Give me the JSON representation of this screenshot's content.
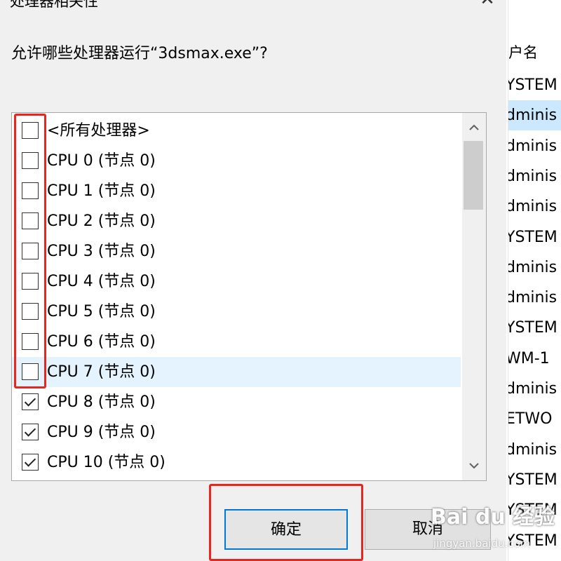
{
  "dialog": {
    "title": "处理器相关性",
    "close_icon": "✕",
    "question": "允许哪些处理器运行“3dsmax.exe”?",
    "ok_label": "确定",
    "cancel_label": "取消"
  },
  "processor_list": {
    "items": [
      {
        "label": "<所有处理器>",
        "checked": false
      },
      {
        "label": "CPU 0 (节点 0)",
        "checked": false
      },
      {
        "label": "CPU 1 (节点 0)",
        "checked": false
      },
      {
        "label": "CPU 2 (节点 0)",
        "checked": false
      },
      {
        "label": "CPU 3 (节点 0)",
        "checked": false
      },
      {
        "label": "CPU 4 (节点 0)",
        "checked": false
      },
      {
        "label": "CPU 5 (节点 0)",
        "checked": false
      },
      {
        "label": "CPU 6 (节点 0)",
        "checked": false
      },
      {
        "label": "CPU 7 (节点 0)",
        "checked": false,
        "highlighted": true
      },
      {
        "label": "CPU 8 (节点 0)",
        "checked": true
      },
      {
        "label": "CPU 9 (节点 0)",
        "checked": true
      },
      {
        "label": "CPU 10 (节点 0)",
        "checked": true
      }
    ],
    "scroll_up_icon": "chevron-up-icon",
    "scroll_down_icon": "chevron-down-icon"
  },
  "background_window": {
    "header": "户名",
    "rows": [
      "YSTEM",
      "dminis",
      "dminis",
      "dminis",
      "dminis",
      "YSTEM",
      "dminis",
      "dminis",
      "YSTEM",
      "WM-1",
      "dminis",
      "ETWO",
      "dminis",
      "YSTEM",
      "YSTEM",
      "YSTEM"
    ],
    "selected_index": 1
  },
  "watermark": {
    "text": "Bai du 经验",
    "sub": "jingyan.baidu.com"
  },
  "colors": {
    "annotation": "#e8261f",
    "accent": "#0078d7",
    "row_highlight": "#e5f3ff",
    "selection": "#cce8ff"
  }
}
